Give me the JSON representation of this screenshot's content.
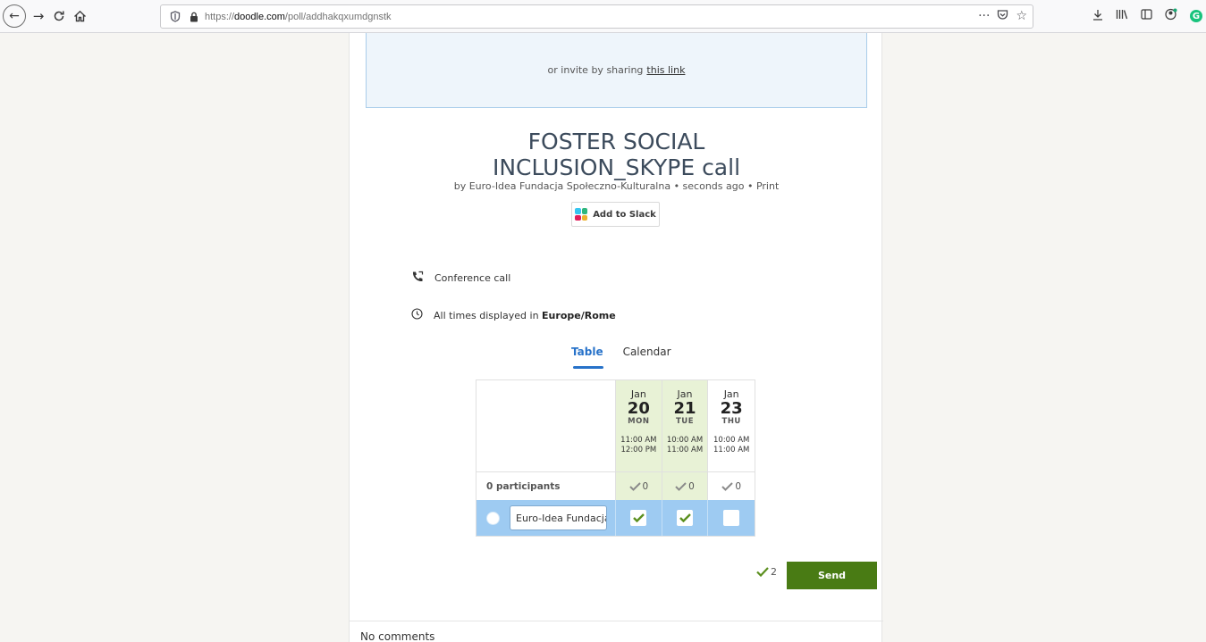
{
  "browser": {
    "url_prefix": "https://",
    "url_domain": "doodle.com",
    "url_path": "/poll/addhakqxumdgnstk",
    "more_label": "···"
  },
  "invite": {
    "text": "or invite by sharing",
    "link": "this link"
  },
  "poll": {
    "title_line1": "FOSTER SOCIAL",
    "title_line2": "INCLUSION_SKYPE call",
    "byline": "by Euro-Idea Fundacja Społeczno-Kulturalna • seconds ago • Print",
    "slack_label": "Add to Slack",
    "location": "Conference call",
    "timezone_prefix": "All times displayed in",
    "timezone": "Europe/Rome"
  },
  "tabs": [
    "Table",
    "Calendar"
  ],
  "table": {
    "participants_label": "0 participants",
    "options": [
      {
        "month": "Jan",
        "day": "20",
        "weekday": "MON",
        "start": "11:00 AM",
        "end": "12:00 PM",
        "count": "0",
        "selected": true
      },
      {
        "month": "Jan",
        "day": "21",
        "weekday": "TUE",
        "start": "10:00 AM",
        "end": "11:00 AM",
        "count": "0",
        "selected": true
      },
      {
        "month": "Jan",
        "day": "23",
        "weekday": "THU",
        "start": "10:00 AM",
        "end": "11:00 AM",
        "count": "0",
        "selected": false
      }
    ],
    "name_value": "Euro-Idea Fundacja"
  },
  "send": {
    "count": "2",
    "label": "Send"
  },
  "comments": "No comments",
  "colors": {
    "accent_blue": "#2772c9",
    "send_green": "#497b14",
    "selected_bg": "#e8f2d6",
    "entry_row": "#9ecbf2"
  }
}
